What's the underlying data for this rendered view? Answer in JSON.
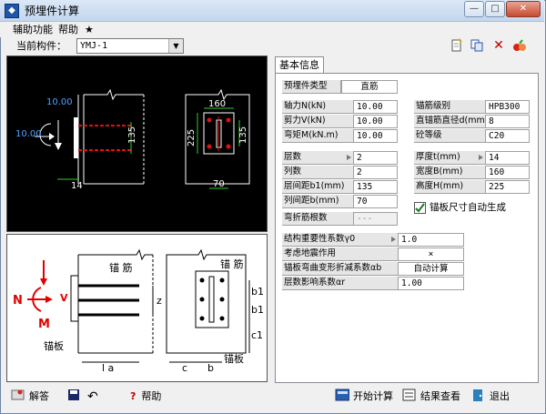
{
  "window": {
    "title": "预埋件计算"
  },
  "menu": [
    "辅助功能",
    "帮助",
    "★"
  ],
  "toolbar": {
    "current_label": "当前构件：",
    "current_value": "YMJ-1"
  },
  "tab": "基本信息",
  "cad": {
    "left_labels": [
      "10.00",
      "10.00",
      "135",
      "14"
    ],
    "right_labels": [
      "160",
      "225",
      "135",
      "70"
    ]
  },
  "diagram": {
    "labels": [
      "锚 筋",
      "V",
      "N",
      "M",
      "z",
      "锚板",
      "l a",
      "锚 筋",
      "b1",
      "b1",
      "c1",
      "c",
      "b",
      "锚板"
    ]
  },
  "params": {
    "type_label": "预埋件类型",
    "type_value": "直筋",
    "grade_label": "锚筋级别",
    "grade_value": "HPB300",
    "axial_label": "轴力N(kN)",
    "axial_value": "10.00",
    "dia_label": "直锚筋直径d(mm)",
    "dia_value": "8",
    "shear_label": "剪力V(kN)",
    "shear_value": "10.00",
    "conc_label": "砼等级",
    "conc_value": "C20",
    "moment_label": "弯矩M(kN.m)",
    "moment_value": "10.00",
    "layers_label": "层数",
    "layers_value": "2",
    "thick_label": "厚度t(mm)",
    "thick_value": "14",
    "cols_label": "列数",
    "cols_value": "2",
    "width_label": "宽度B(mm)",
    "width_value": "160",
    "layer_sp_label": "层间距b1(mm)",
    "layer_sp_value": "135",
    "height_label": "高度H(mm)",
    "height_value": "225",
    "col_sp_label": "列间距b(mm)",
    "col_sp_value": "70",
    "bent_label": "弯折筋根数",
    "bent_value": "---",
    "autogen": "锚板尺寸自动生成",
    "gamma_label": "结构重要性系数γ0",
    "gamma_value": "1.0",
    "seismic_label": "考虑地震作用",
    "seismic_value": "×",
    "bend_coef_label": "锚板弯曲变形折减系数αb",
    "bend_coef_value": "自动计算",
    "layer_coef_label": "层数影响系数αr",
    "layer_coef_value": "1.00"
  },
  "bottom": {
    "answer": "解答",
    "help": "帮助",
    "start": "开始计算",
    "result": "结果查看",
    "exit": "退出"
  }
}
